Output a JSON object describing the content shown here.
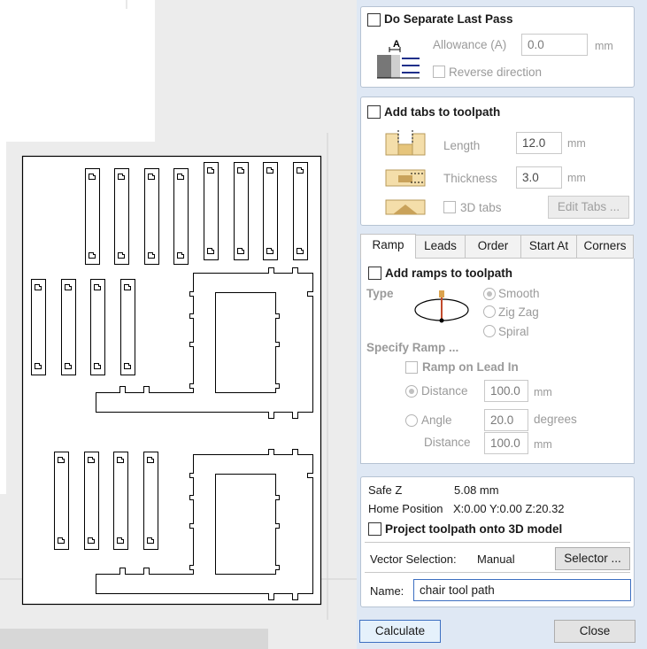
{
  "last_pass": {
    "title": "Do Separate Last Pass",
    "allowance_label": "Allowance (A)",
    "allowance_value": "0.0",
    "allowance_unit": "mm",
    "reverse_label": "Reverse direction",
    "icon_letter": "A"
  },
  "tabs_group": {
    "title": "Add tabs to toolpath",
    "length_label": "Length",
    "length_value": "12.0",
    "length_unit": "mm",
    "thickness_label": "Thickness",
    "thickness_value": "3.0",
    "thickness_unit": "mm",
    "tabs3d_label": "3D tabs",
    "edit_tabs_button": "Edit Tabs ..."
  },
  "tab_strip": [
    "Ramp",
    "Leads",
    "Order",
    "Start At",
    "Corners"
  ],
  "ramp": {
    "title": "Add ramps to toolpath",
    "type_label": "Type",
    "type_options": [
      "Smooth",
      "Zig Zag",
      "Spiral"
    ],
    "selected_type": "Smooth",
    "specify_label": "Specify Ramp ...",
    "lead_in_label": "Ramp on Lead In",
    "distance_label": "Distance",
    "distance_value": "100.0",
    "distance_unit": "mm",
    "angle_label": "Angle",
    "angle_value": "20.0",
    "angle_unit": "degrees",
    "angle_distance_label": "Distance",
    "angle_distance_value": "100.0",
    "angle_distance_unit": "mm"
  },
  "info": {
    "safe_z_label": "Safe Z",
    "safe_z_value": "5.08 mm",
    "home_label": "Home Position",
    "home_value": "X:0.00 Y:0.00 Z:20.32",
    "project_label": "Project toolpath onto 3D model",
    "vector_label": "Vector Selection:",
    "vector_value": "Manual",
    "selector_button": "Selector ...",
    "name_label": "Name:",
    "name_value": "chair tool path"
  },
  "footer": {
    "calculate_button": "Calculate",
    "close_button": "Close"
  },
  "colors": {
    "panel_bg": "#dfe8f4",
    "group_border": "#b6c3d3",
    "tab_icon_wood": "#f4deaa",
    "accent_blue": "#3d6fc1"
  }
}
